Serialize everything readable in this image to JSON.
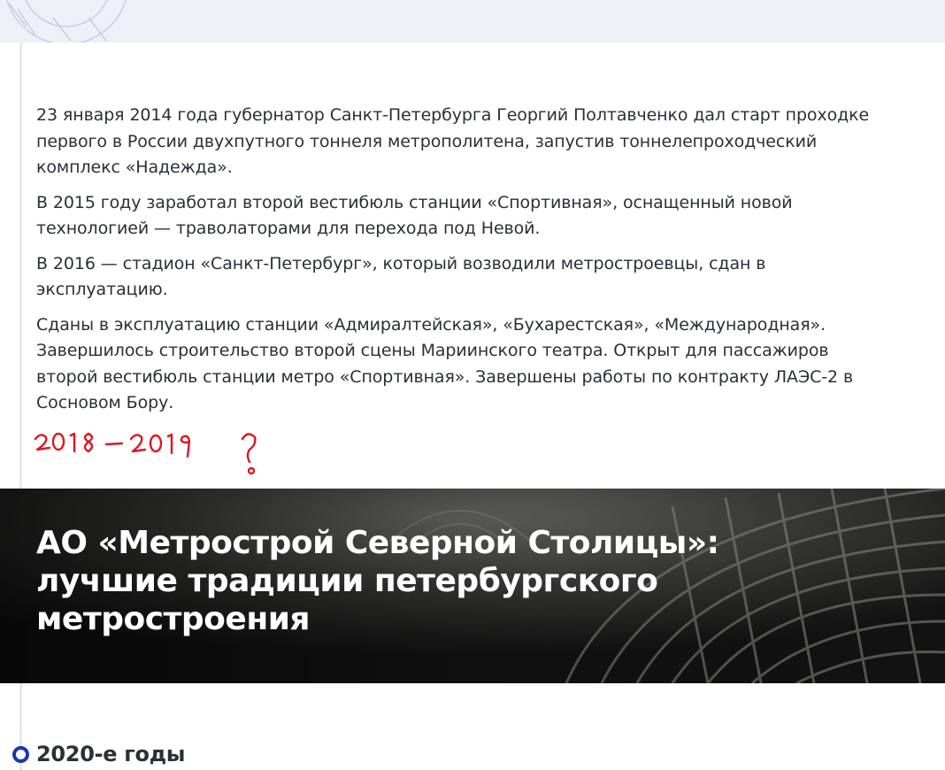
{
  "paragraphs": [
    "23 января 2014 года губернатор Санкт-Петербурга Георгий Полтавченко дал старт проходке первого в России двухпутного тоннеля метрополитена, запустив тоннелепроходческий комплекс «Надежда».",
    "В 2015 году заработал второй вестибюль станции «Спортивная», оснащенный новой технологией — траволаторами для перехода под Невой.",
    "В 2016 — стадион «Санкт-Петербург», который возводили метростроевцы, сдан в эксплуатацию.",
    "Сданы в эксплуатацию станции «Адмиралтейская», «Бухарестская», «Международная». Завершилось строительство второй сцены Мариинского театра. Открыт для пассажиров второй вестибюль станции метро «Спортивная». Завершены работы по контракту ЛАЭС-2 в Сосновом Бору."
  ],
  "annotation": {
    "text": "2018 – 2019 ?",
    "color": "#e0151d"
  },
  "banner": {
    "title": "АО «Метрострой Северной Столицы»: лучшие традиции петербургского метростроения"
  },
  "timeline": {
    "decade_label": "2020-е годы",
    "dot_color": "#1a3aa8"
  }
}
